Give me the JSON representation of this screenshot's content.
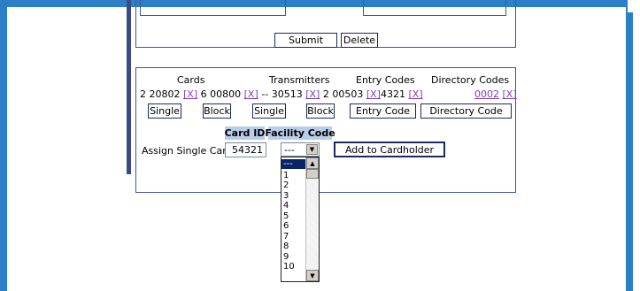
{
  "form": {
    "submit_label": "Submit",
    "delete_label": "Delete"
  },
  "headers": {
    "cards": "Cards",
    "transmitters": "Transmitters",
    "entry_codes": "Entry Codes",
    "directory_codes": "Directory Codes"
  },
  "values": {
    "card_1": "2 20802",
    "card_2": "6 00800",
    "separator": "--",
    "transmitter_1": "30513",
    "transmitter_2": "2 00503",
    "entry_code": "4321",
    "directory_code": "0002",
    "remove_marker": "[X]"
  },
  "buttons": {
    "single_card": "Single",
    "block_card": "Block",
    "single_transmitter": "Single",
    "block_transmitter": "Block",
    "entry_code": "Entry Code",
    "directory_code": "Directory Code",
    "add_to_cardholder": "Add to Cardholder"
  },
  "assign": {
    "label": "Assign Single Card:",
    "card_id_header": "Card ID",
    "facility_code_header": "Facility Code",
    "card_id_value": "54321",
    "facility_selected": "---"
  },
  "facility_options": [
    "---",
    "1",
    "2",
    "3",
    "4",
    "5",
    "6",
    "7",
    "8",
    "9",
    "10"
  ],
  "colors": {
    "frame_blue": "#2c7fc6",
    "link_purple": "#7b3fbf",
    "header_bg": "#b9cde8",
    "selection_bg": "#0a246a"
  }
}
